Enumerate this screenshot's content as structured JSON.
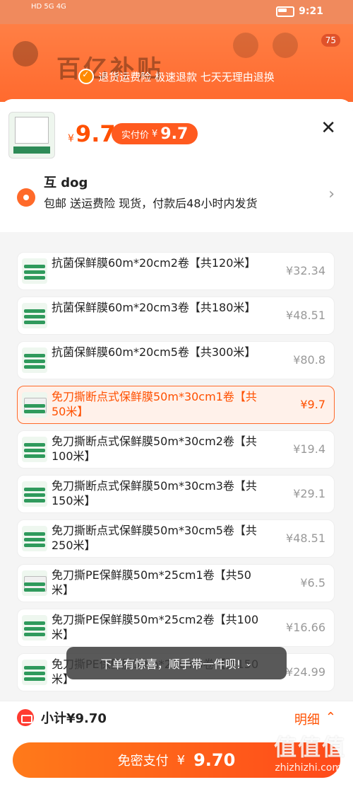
{
  "status": {
    "left": "HD 5G 4G",
    "time": "9:21"
  },
  "background": {
    "title": "百亿补贴",
    "badge": "75",
    "promise": "退货运费险 极速退款 七天无理由退换"
  },
  "header": {
    "currency": "¥",
    "price": "9.7",
    "real_price_label": "实付价",
    "real_price_currency": "¥",
    "real_price": "9.7",
    "close_icon": "close-icon"
  },
  "address": {
    "name": "互 dog",
    "line": "包邮 送运费险 现货，付款后48小时内发货"
  },
  "options": [
    {
      "name": "抗菌保鲜膜60m*20cm2卷【共120米】",
      "price": "¥32.34",
      "selected": false
    },
    {
      "name": "抗菌保鲜膜60m*20cm3卷【共180米】",
      "price": "¥48.51",
      "selected": false
    },
    {
      "name": "抗菌保鲜膜60m*20cm5卷【共300米】",
      "price": "¥80.8",
      "selected": false
    },
    {
      "name": "免刀撕断点式保鲜膜50m*30cm1卷【共50米】",
      "price": "¥9.7",
      "selected": true
    },
    {
      "name": "免刀撕断点式保鲜膜50m*30cm2卷【共100米】",
      "price": "¥19.4",
      "selected": false
    },
    {
      "name": "免刀撕断点式保鲜膜50m*30cm3卷【共150米】",
      "price": "¥29.1",
      "selected": false
    },
    {
      "name": "免刀撕断点式保鲜膜50m*30cm5卷【共250米】",
      "price": "¥48.51",
      "selected": false
    },
    {
      "name": "免刀撕PE保鲜膜50m*25cm1卷【共50米】",
      "price": "¥6.5",
      "selected": false
    },
    {
      "name": "免刀撕PE保鲜膜50m*25cm2卷【共100米】",
      "price": "¥16.66",
      "selected": false
    },
    {
      "name": "免刀撕PE保鲜膜50m*25cm3卷【共150米】",
      "price": "¥24.99",
      "selected": false
    }
  ],
  "toast": "下单有惊喜，顺手带一件呗!",
  "footer": {
    "subtotal": "小计¥9.70",
    "detail": "明细",
    "pay_label": "免密支付",
    "pay_currency": "¥",
    "pay_value": "9.70",
    "watermark": "值值值",
    "watermark_url": "zhizhizhi.com"
  }
}
